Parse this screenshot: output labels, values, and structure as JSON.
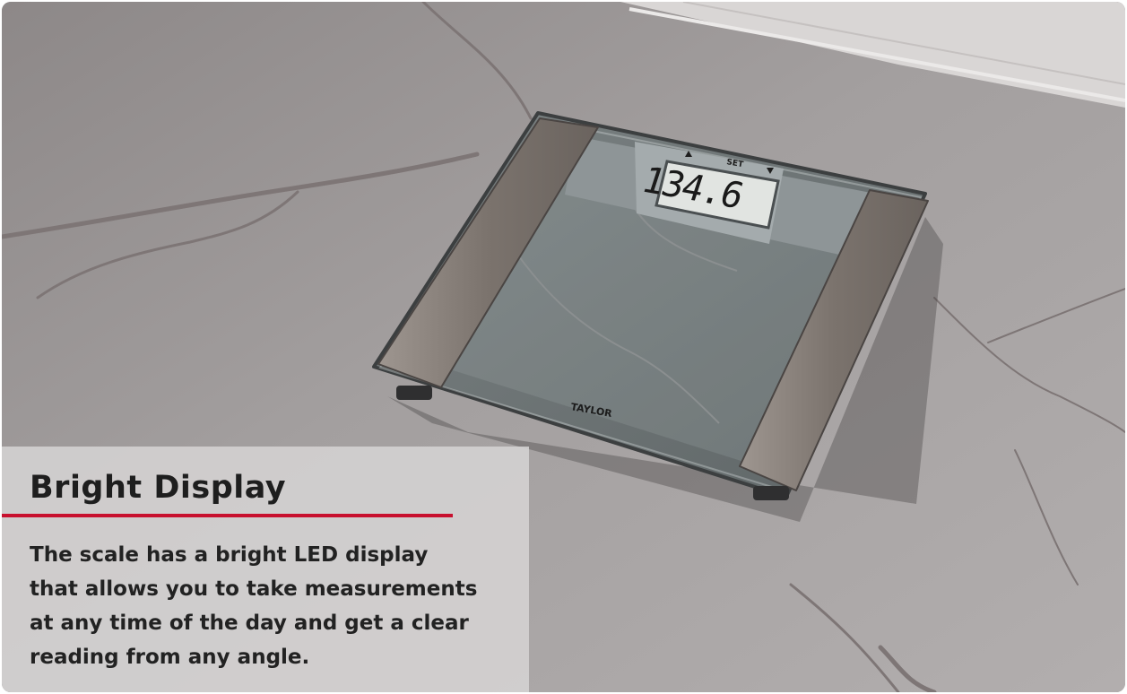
{
  "scene": {
    "display_reading": "134.6",
    "display_label": "SET",
    "brand": "TAYLOR",
    "colors": {
      "marble": "#9a9595",
      "glass": "#6f7677",
      "steel_pad": "#8a817a",
      "lcd": "#dfe2df"
    }
  },
  "caption": {
    "title": "Bright Display",
    "body_lines": [
      "The scale has a bright LED display",
      "that allows you to take measurements",
      "at any time of the day and get a clear",
      "reading from any angle."
    ],
    "accent_color": "#c8102e"
  }
}
